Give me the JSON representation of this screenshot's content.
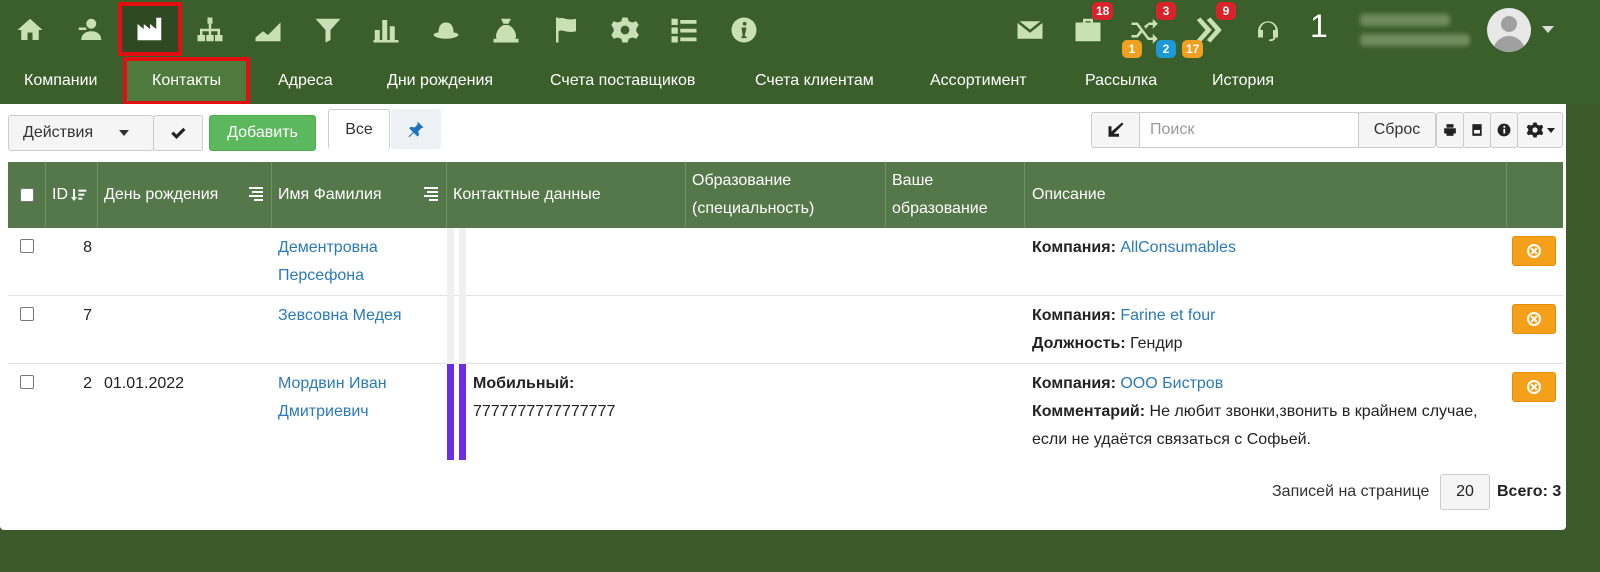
{
  "topbar": {
    "icons": [
      "home-icon",
      "contacts-icon",
      "factory-icon",
      "org-structure-icon",
      "area-chart-icon",
      "filter-icon",
      "bar-chart-icon",
      "hat-icon",
      "money-bag-icon",
      "flag-icon",
      "gear-icon",
      "list-icon",
      "info-icon"
    ],
    "mail_icon": "envelope-icon",
    "briefcase_badge": "18",
    "briefcase_badge2": "1",
    "shuffle_badge": "3",
    "shuffle_badge2": "2",
    "forward_badge": "9",
    "forward_badge2": "17",
    "counter": "1"
  },
  "nav": {
    "tabs": [
      "Компании",
      "Контакты",
      "Адреса",
      "Дни рождения",
      "Счета поставщиков",
      "Счета клиентам",
      "Ассортимент",
      "Рассылка",
      "История"
    ],
    "active": "Контакты"
  },
  "toolbar": {
    "actions_label": "Действия",
    "add_label": "Добавить",
    "all_label": "Все",
    "search_placeholder": "Поиск",
    "reset_label": "Сброс"
  },
  "table": {
    "headers": {
      "id": "ID",
      "birthday": "День рождения",
      "name": "Имя Фамилия",
      "contacts": "Контактные данные",
      "education_1": "Образование",
      "education_2": "(специальность)",
      "your_edu_1": "Ваше",
      "your_edu_2": "образование",
      "description": "Описание"
    },
    "rows": [
      {
        "id": "8",
        "birthday": "",
        "name_1": "Дементровна",
        "name_2": "Персефона",
        "company_label": "Компания:",
        "company": "AllConsumables"
      },
      {
        "id": "7",
        "birthday": "",
        "name_1": "Зевсовна Медея",
        "company_label": "Компания:",
        "company": "Farine et four",
        "position_label": "Должность:",
        "position": "Гендир"
      },
      {
        "id": "2",
        "birthday": "01.01.2022",
        "name_1": "Мордвин Иван",
        "name_2": "Дмитриевич",
        "phone_label": "Мобильный:",
        "phone": "7777777777777777",
        "company_label": "Компания:",
        "company": "ООО Бистров",
        "comment_label": "Комментарий:",
        "comment_1": "Не любит звонки,звонить в крайнем случае,",
        "comment_2": "если не удаётся связаться с Софьей."
      }
    ]
  },
  "footer": {
    "per_page_label": "Записей на странице",
    "per_page": "20",
    "total": "Всего: 3"
  },
  "colors": {
    "topbar": "#3b5f2b",
    "table_header": "#55784a",
    "delete_button": "#f5a01a",
    "contact_stripe": "#6a2ee8",
    "highlight": "#e01010"
  }
}
